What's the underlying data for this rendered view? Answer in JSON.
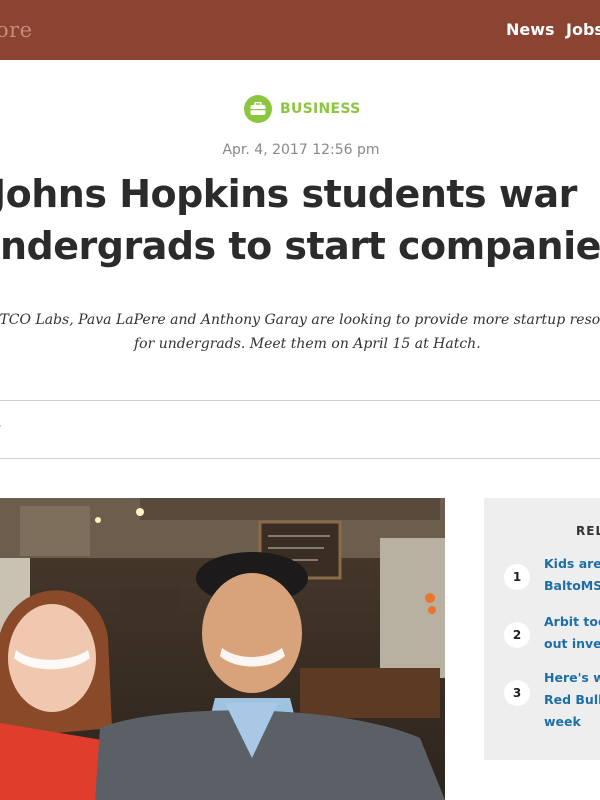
{
  "header": {
    "brand_fragment": "ore",
    "nav": [
      "News",
      "Jobs"
    ]
  },
  "article": {
    "category": "BUSINESS",
    "category_icon": "briefcase-icon",
    "timestamp": "Apr. 4, 2017 12:56 pm",
    "headline_line1": "Johns Hopkins students war",
    "headline_line2": "ndergrads to start companie",
    "dek_line1": "h TCO Labs, Pava LaPere and Anthony Garay are looking to provide more startup resou",
    "dek_line2": "for undergrads. Meet them on April 15 at Hatch.",
    "byline_fragment": "›"
  },
  "related": {
    "title": "REL",
    "items": [
      {
        "num": "1",
        "line1": "Kids are i",
        "line2": "BaltoMSD"
      },
      {
        "num": "2",
        "line1": "Arbit tool",
        "line2": "out inves"
      },
      {
        "num": "3",
        "line1": "Here's wh",
        "line2": "Red Bull A",
        "line3": "week"
      }
    ]
  },
  "colors": {
    "header_bg": "#8b4332",
    "category": "#8cc63f",
    "link": "#1e6fa8"
  }
}
